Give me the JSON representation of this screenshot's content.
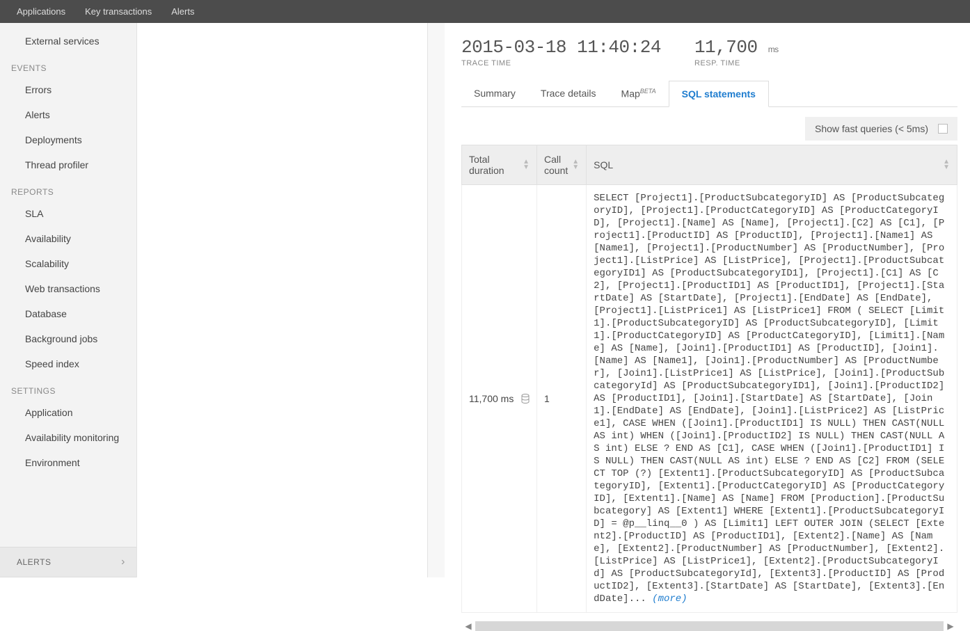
{
  "topnav": {
    "items": [
      "Applications",
      "Key transactions",
      "Alerts"
    ]
  },
  "sidebar": {
    "top_items": [
      "External services"
    ],
    "sections": [
      {
        "title": "EVENTS",
        "items": [
          "Errors",
          "Alerts",
          "Deployments",
          "Thread profiler"
        ]
      },
      {
        "title": "REPORTS",
        "items": [
          "SLA",
          "Availability",
          "Scalability",
          "Web transactions",
          "Database",
          "Background jobs",
          "Speed index"
        ]
      },
      {
        "title": "SETTINGS",
        "items": [
          "Application",
          "Availability monitoring",
          "Environment"
        ]
      }
    ],
    "footer_label": "ALERTS"
  },
  "trace": {
    "time_value": "2015-03-18 11:40:24",
    "time_label": "TRACE TIME",
    "resp_value": "11,700",
    "resp_unit": "ms",
    "resp_label": "RESP. TIME"
  },
  "tabs": {
    "items": [
      {
        "label": "Summary"
      },
      {
        "label": "Trace details"
      },
      {
        "label": "Map",
        "badge": "BETA"
      },
      {
        "label": "SQL statements",
        "active": true
      }
    ]
  },
  "fast_queries": {
    "label": "Show fast queries (< 5ms)",
    "checked": false
  },
  "table": {
    "columns": {
      "duration": "Total duration",
      "call_count": "Call count",
      "sql": "SQL"
    },
    "row": {
      "duration": "11,700 ms",
      "call_count": "1",
      "more_label": "(more)",
      "sql_text": "SELECT [Project1].[ProductSubcategoryID] AS [ProductSubcategoryID], [Project1].[ProductCategoryID] AS [ProductCategoryID], [Project1].[Name] AS [Name], [Project1].[C2] AS [C1], [Project1].[ProductID] AS [ProductID], [Project1].[Name1] AS [Name1], [Project1].[ProductNumber] AS [ProductNumber], [Project1].[ListPrice] AS [ListPrice], [Project1].[ProductSubcategoryID1] AS [ProductSubcategoryID1], [Project1].[C1] AS [C2], [Project1].[ProductID1] AS [ProductID1], [Project1].[StartDate] AS [StartDate], [Project1].[EndDate] AS [EndDate], [Project1].[ListPrice1] AS [ListPrice1] FROM ( SELECT [Limit1].[ProductSubcategoryID] AS [ProductSubcategoryID], [Limit1].[ProductCategoryID] AS [ProductCategoryID], [Limit1].[Name] AS [Name], [Join1].[ProductID1] AS [ProductID], [Join1].[Name] AS [Name1], [Join1].[ProductNumber] AS [ProductNumber], [Join1].[ListPrice1] AS [ListPrice], [Join1].[ProductSubcategoryId] AS [ProductSubcategoryID1], [Join1].[ProductID2] AS [ProductID1], [Join1].[StartDate] AS [StartDate], [Join1].[EndDate] AS [EndDate], [Join1].[ListPrice2] AS [ListPrice1], CASE WHEN ([Join1].[ProductID1] IS NULL) THEN CAST(NULL AS int) WHEN ([Join1].[ProductID2] IS NULL) THEN CAST(NULL AS int) ELSE ? END AS [C1], CASE WHEN ([Join1].[ProductID1] IS NULL) THEN CAST(NULL AS int) ELSE ? END AS [C2] FROM (SELECT TOP (?) [Extent1].[ProductSubcategoryID] AS [ProductSubcategoryID], [Extent1].[ProductCategoryID] AS [ProductCategoryID], [Extent1].[Name] AS [Name] FROM [Production].[ProductSubcategory] AS [Extent1] WHERE [Extent1].[ProductSubcategoryID] = @p__linq__0 ) AS [Limit1] LEFT OUTER JOIN (SELECT [Extent2].[ProductID] AS [ProductID1], [Extent2].[Name] AS [Name], [Extent2].[ProductNumber] AS [ProductNumber], [Extent2].[ListPrice] AS [ListPrice1], [Extent2].[ProductSubcategoryId] AS [ProductSubcategoryId], [Extent3].[ProductID] AS [ProductID2], [Extent3].[StartDate] AS [StartDate], [Extent3].[EndDate]... "
    }
  }
}
